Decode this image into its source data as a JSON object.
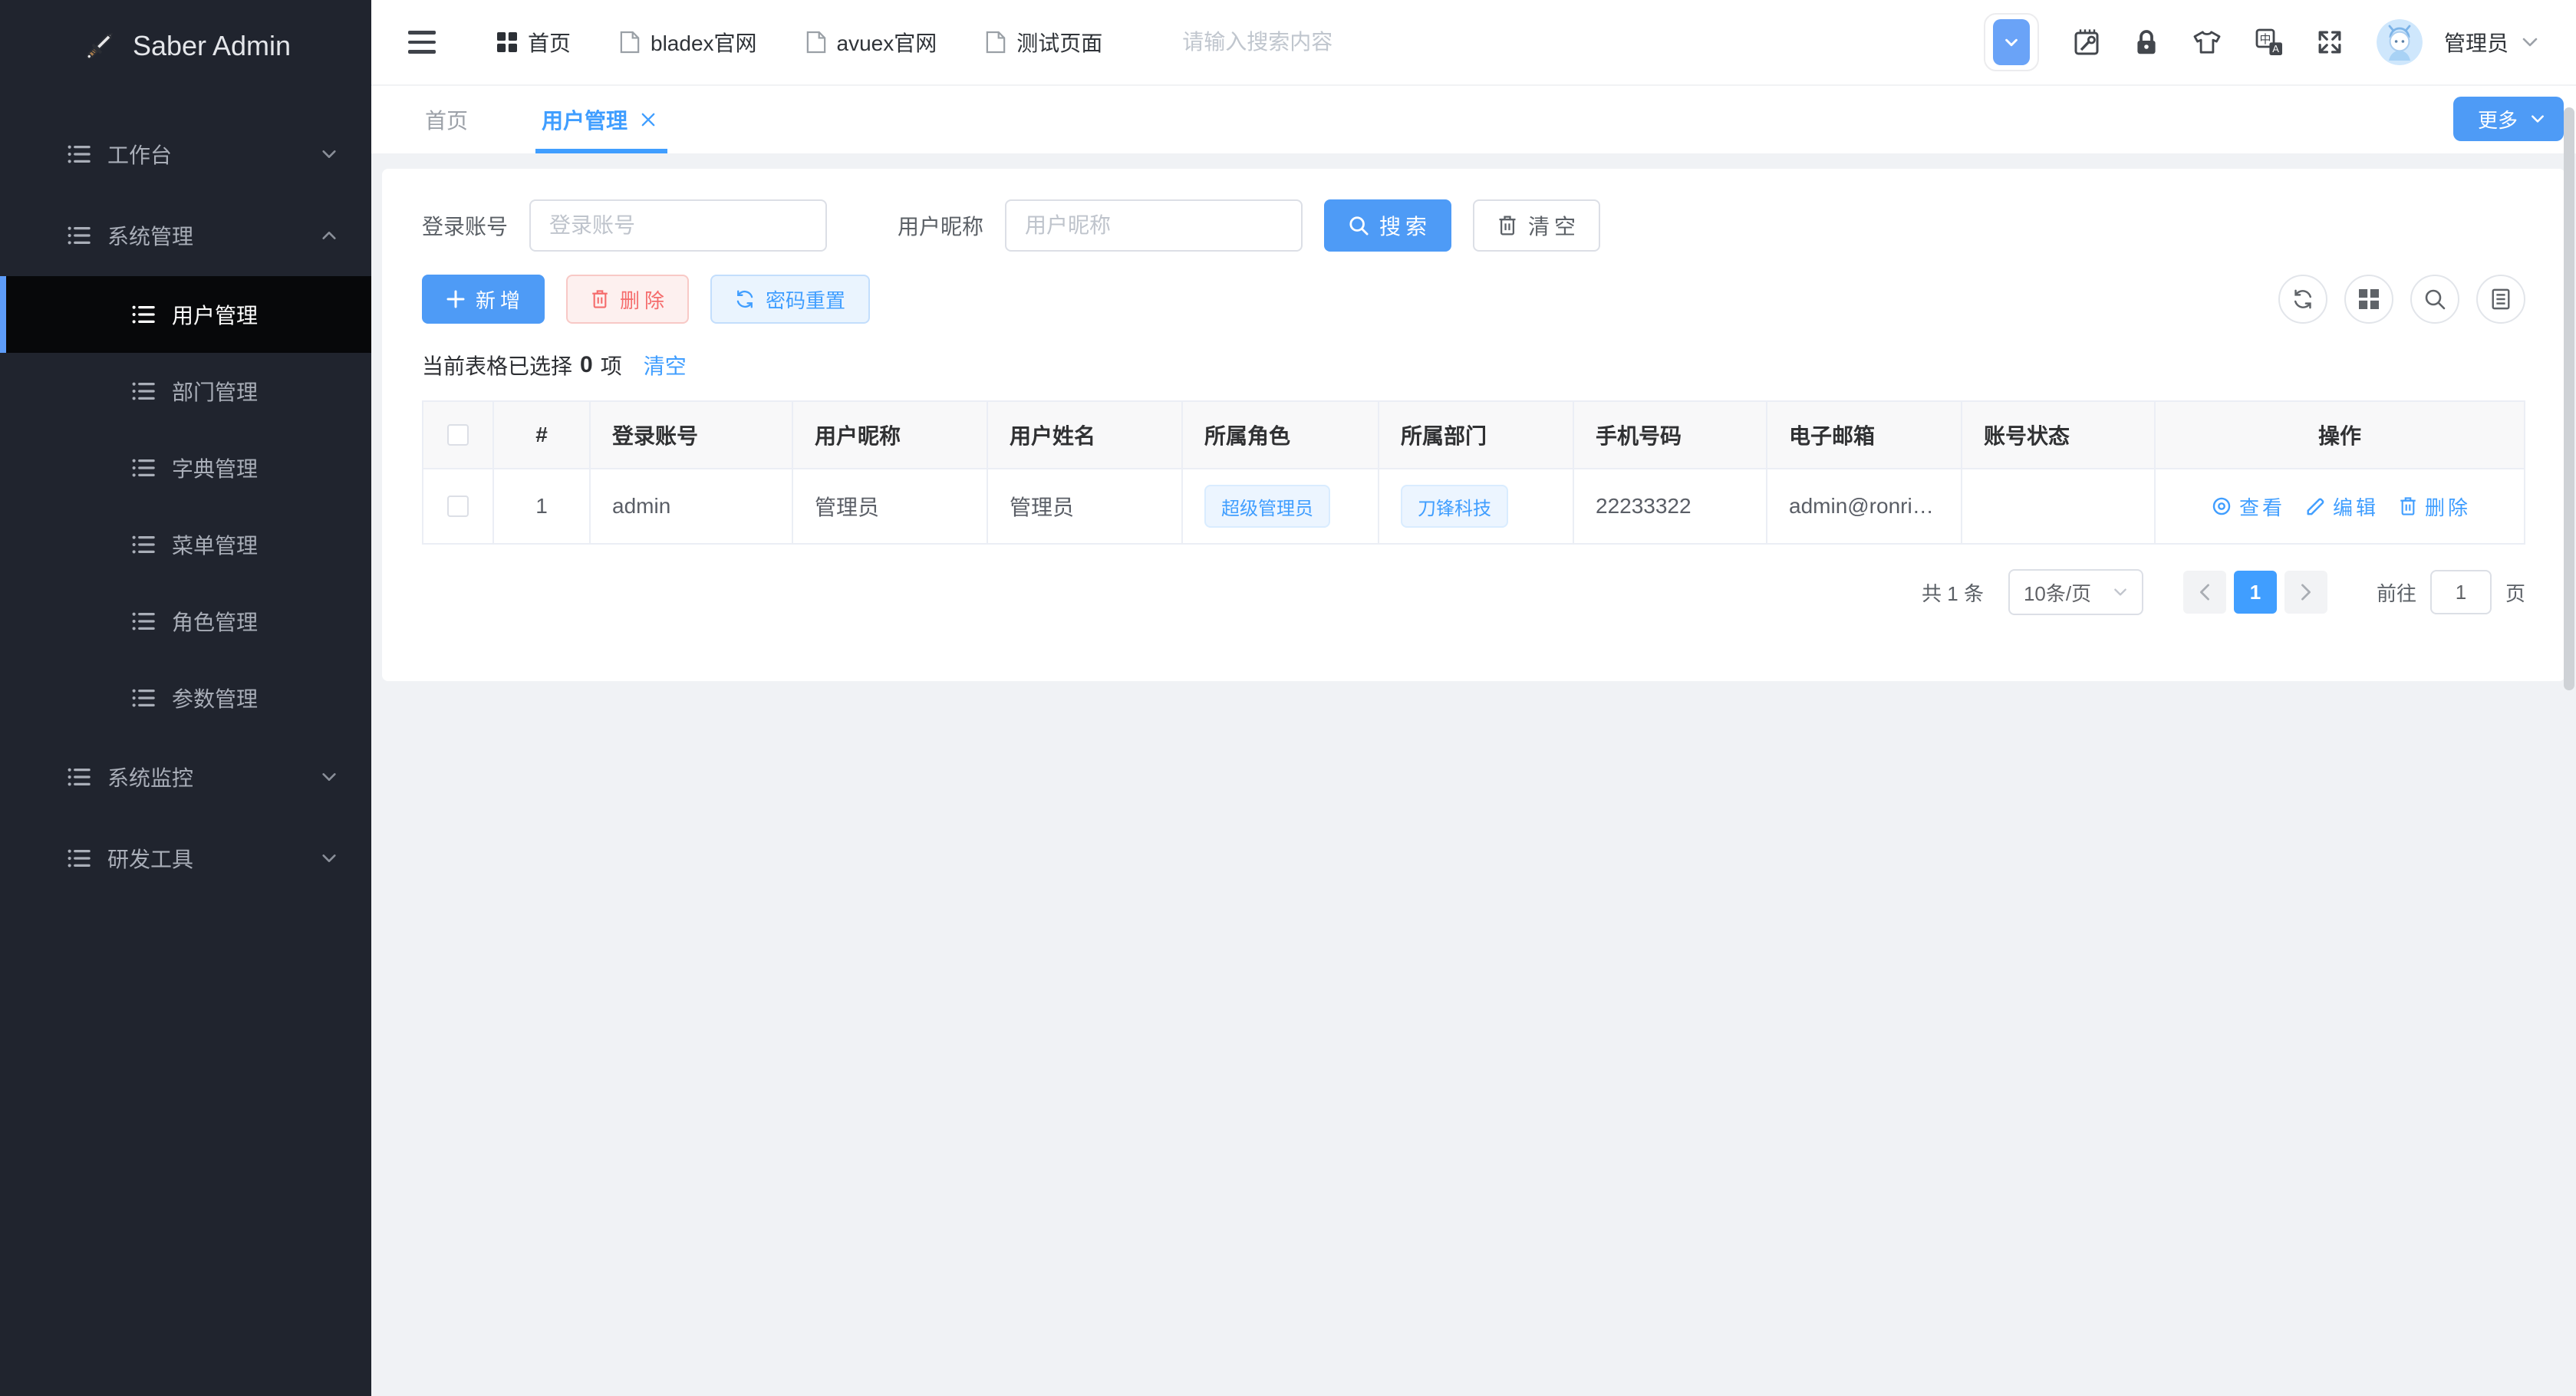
{
  "logo": {
    "title": "Saber Admin"
  },
  "sidebar": {
    "items": [
      {
        "label": "工作台"
      },
      {
        "label": "系统管理"
      },
      {
        "label": "用户管理"
      },
      {
        "label": "部门管理"
      },
      {
        "label": "字典管理"
      },
      {
        "label": "菜单管理"
      },
      {
        "label": "角色管理"
      },
      {
        "label": "参数管理"
      },
      {
        "label": "系统监控"
      },
      {
        "label": "研发工具"
      }
    ]
  },
  "topbar": {
    "nav": [
      {
        "label": "首页"
      },
      {
        "label": "bladex官网"
      },
      {
        "label": "avuex官网"
      },
      {
        "label": "测试页面"
      }
    ],
    "search_placeholder": "请输入搜索内容",
    "username": "管理员"
  },
  "tabs": {
    "items": [
      {
        "label": "首页"
      },
      {
        "label": "用户管理"
      }
    ],
    "more_label": "更多"
  },
  "filters": {
    "account_label": "登录账号",
    "account_placeholder": "登录账号",
    "nickname_label": "用户昵称",
    "nickname_placeholder": "用户昵称",
    "search_label": "搜索",
    "clear_label": "清空"
  },
  "toolbar": {
    "add_label": "新增",
    "delete_label": "删除",
    "reset_label": "密码重置"
  },
  "selection": {
    "prefix": "当前表格已选择",
    "count": "0",
    "suffix": "项",
    "clear_label": "清空"
  },
  "table": {
    "headers": [
      "#",
      "登录账号",
      "用户昵称",
      "用户姓名",
      "所属角色",
      "所属部门",
      "手机号码",
      "电子邮箱",
      "账号状态",
      "操作"
    ],
    "row": {
      "index": "1",
      "account": "admin",
      "nickname": "管理员",
      "name": "管理员",
      "role": "超级管理员",
      "dept": "刀锋科技",
      "phone": "22233322",
      "email": "admin@ronris...",
      "status": "",
      "view_label": "查看",
      "edit_label": "编辑",
      "delete_label": "删除"
    }
  },
  "pagination": {
    "total": "共 1 条",
    "page_size": "10条/页",
    "current": "1",
    "goto_label": "前往",
    "goto_value": "1",
    "page_suffix": "页"
  },
  "colors": {
    "primary": "#409eff",
    "primary-button": "#4e9bf6",
    "danger": "#f56c6c",
    "danger-bg": "#fdf0ef",
    "danger-border": "#f8c9c6",
    "info-bg": "#eaf4fe",
    "info-border": "#c3defc",
    "sidebar-bg": "#20242e",
    "sidebar-active-bg": "#07080a",
    "sidebar-active-bar": "#5d9cf8",
    "tag-bg": "#ecf5ff",
    "tag-border": "#d9ecff",
    "page-bg": "#f0f2f5",
    "border": "#dcdfe6",
    "table-border": "#ebeef5",
    "header-bg": "#f8f8f9"
  }
}
